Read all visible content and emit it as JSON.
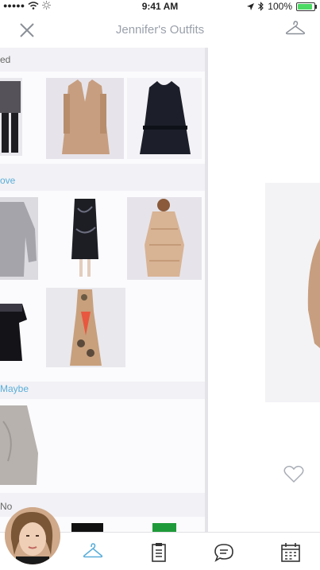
{
  "status_bar": {
    "signal_dots": "●●●●●",
    "time": "9:41 AM",
    "battery_text": "100%",
    "icons": [
      "wifi-icon",
      "brightness-icon",
      "location-arrow-icon",
      "bluetooth-icon",
      "battery-icon"
    ]
  },
  "header": {
    "title": "Jennifer's Outfits",
    "left_icon": "close-icon",
    "right_icon": "hanger-icon"
  },
  "sections": [
    {
      "label": "ed",
      "color": "#666666"
    },
    {
      "label": "ove",
      "color": "#5aaed9"
    },
    {
      "label": "Maybe",
      "color": "#5aaed9"
    },
    {
      "label": "No",
      "color": "#666666"
    }
  ],
  "tabbar": {
    "items": [
      "hanger-icon",
      "checklist-icon",
      "chat-icon",
      "calendar-icon"
    ],
    "active_color": "#5aaed9"
  },
  "detail": {
    "favorite_icon": "heart-icon"
  }
}
